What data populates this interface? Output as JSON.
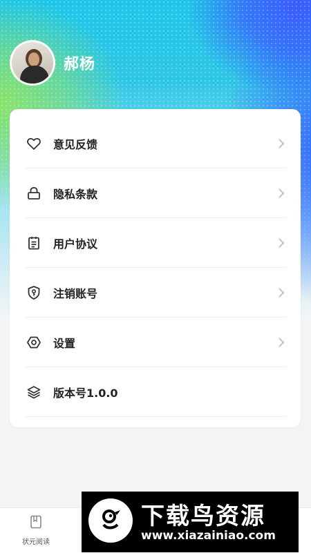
{
  "profile": {
    "name": "郝杨"
  },
  "menu": [
    {
      "label": "意见反馈",
      "icon": "heart-icon"
    },
    {
      "label": "隐私条款",
      "icon": "lock-icon"
    },
    {
      "label": "用户协议",
      "icon": "clipboard-icon"
    },
    {
      "label": "注销账号",
      "icon": "shield-key-icon"
    },
    {
      "label": "设置",
      "icon": "hexagon-settings-icon"
    },
    {
      "label": "版本号1.0.0",
      "icon": "layers-icon"
    }
  ],
  "tabbar": {
    "items": [
      {
        "label": "状元阅读",
        "icon": "book-icon"
      }
    ]
  },
  "watermark": {
    "title": "下载鸟资源",
    "url": "www.xiazainiao.com"
  }
}
